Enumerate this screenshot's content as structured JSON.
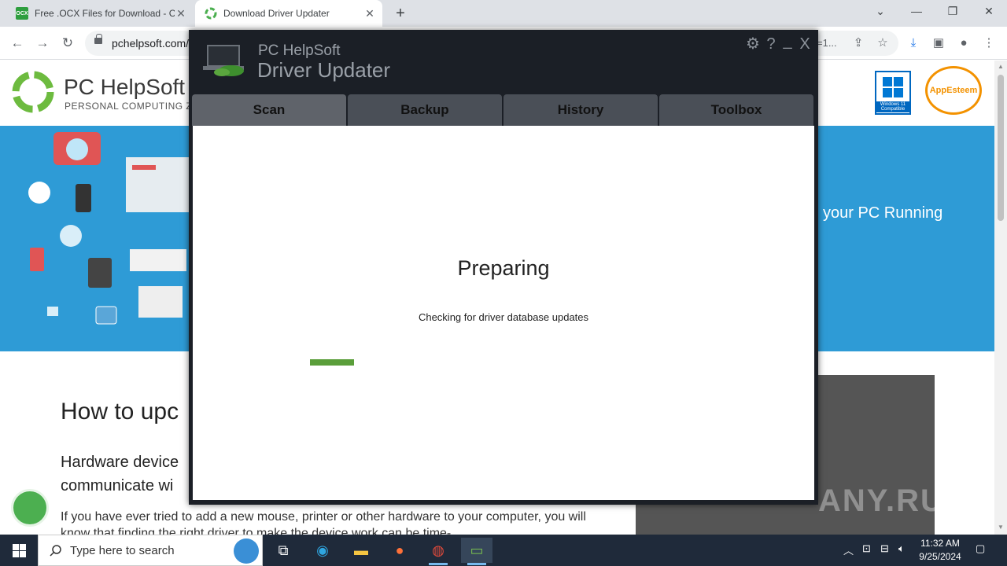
{
  "browser": {
    "tabs": [
      {
        "title": "Free .OCX Files for Download - C",
        "favicon": "OCX",
        "favicon_color": "#2e9e3e",
        "active": false
      },
      {
        "title": "Download Driver Updater",
        "favicon": "",
        "favicon_color": "#4caf50",
        "active": true
      }
    ],
    "new_tab": "+",
    "url": "pchelpsoft.com/",
    "url_right": "=1..."
  },
  "site": {
    "brand": "PC HelpSoft",
    "brand_sub": "PERSONAL COMPUTING ZEN",
    "win11_label": "Windows 11 Compatible",
    "appesteem_label": "AppEsteem",
    "hero_text": "your PC Running",
    "article_heading": "How to upc",
    "article_p1_line1": "Hardware device",
    "article_p1_line2": "communicate wi",
    "article_p2": "If you have ever tried to add a new mouse, printer or other hardware to your computer, you will know that finding the right driver to make the device work can be time-",
    "watermark": "ANY.RUN"
  },
  "app": {
    "brand": "PC HelpSoft",
    "product": "Driver Updater",
    "tabs": [
      "Scan",
      "Backup",
      "History",
      "Toolbox"
    ],
    "active_tab": "Scan",
    "status_title": "Preparing",
    "status_subtitle": "Checking for driver database updates",
    "progress_color": "#5a9e3a",
    "controls": {
      "settings": "⚙",
      "help": "?",
      "minimize": "_",
      "close": "X"
    }
  },
  "taskbar": {
    "search_placeholder": "Type here to search",
    "time": "11:32 AM",
    "date": "9/25/2024"
  }
}
